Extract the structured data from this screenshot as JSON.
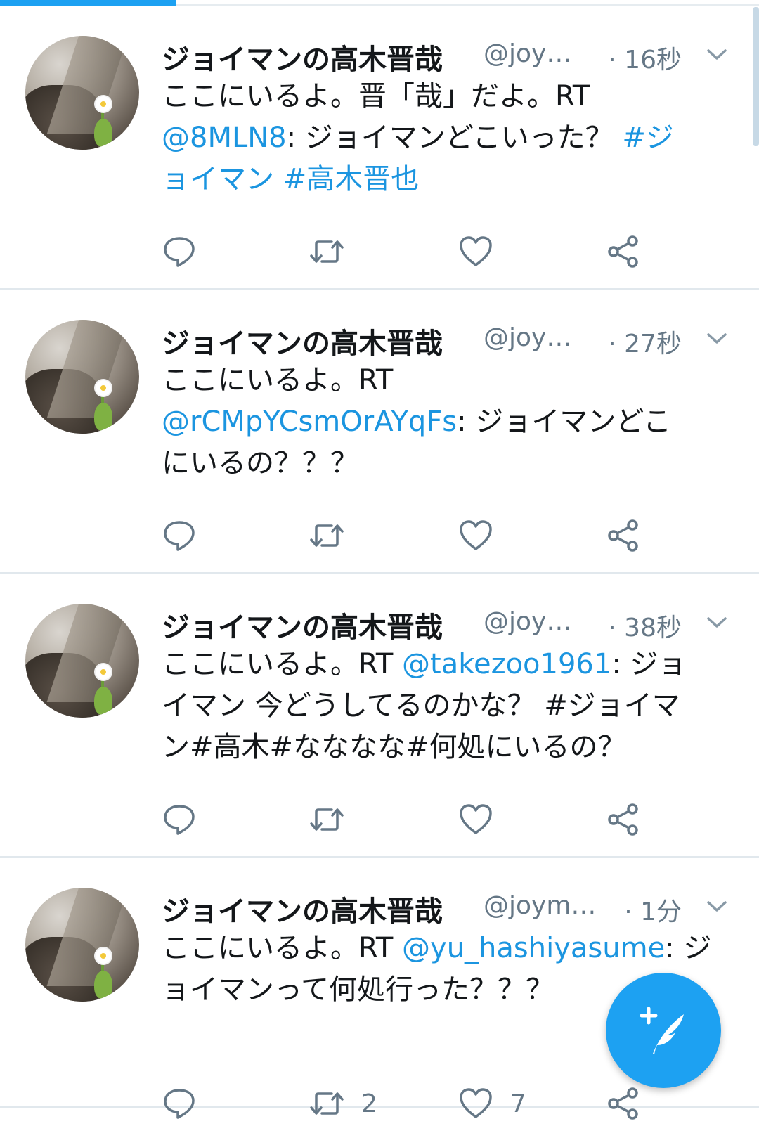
{
  "colors": {
    "accent": "#1da1f2",
    "link": "#1b95e0",
    "muted": "#657786",
    "text": "#14171a"
  },
  "tweets": [
    {
      "name": "ジョイマンの高木晋哉",
      "handle": "@joy…",
      "time": "· 16秒",
      "segments": [
        {
          "t": "ここにいるよ。晋「哉」だよ。RT\n"
        },
        {
          "t": "@8MLN8",
          "link": true
        },
        {
          "t": ": ジョイマンどこいった？ "
        },
        {
          "t": "#ジ\nョイマン #高木晋也",
          "link": true
        }
      ],
      "retweets": "",
      "likes": ""
    },
    {
      "name": "ジョイマンの高木晋哉",
      "handle": "@joy…",
      "time": "· 27秒",
      "segments": [
        {
          "t": "ここにいるよ。RT\n"
        },
        {
          "t": "@rCMpYCsmOrAYqFs",
          "link": true
        },
        {
          "t": ": ジョイマンどこ\nにいるの？？？"
        }
      ],
      "retweets": "",
      "likes": ""
    },
    {
      "name": "ジョイマンの高木晋哉",
      "handle": "@joy…",
      "time": "· 38秒",
      "segments": [
        {
          "t": "ここにいるよ。RT "
        },
        {
          "t": "@takezoo1961",
          "link": true
        },
        {
          "t": ": ジョ\nイマン 今どうしてるのかな？ #ジョイマ\nン#高木#なななな#何処にいるの？"
        }
      ],
      "retweets": "",
      "likes": ""
    },
    {
      "name": "ジョイマンの高木晋哉",
      "handle": "@joym…",
      "time": "· 1分",
      "segments": [
        {
          "t": "ここにいるよ。RT "
        },
        {
          "t": "@yu_hashiyasume",
          "link": true
        },
        {
          "t": ": ジ\nョイマンって何処行った？？？"
        }
      ],
      "retweets": "2",
      "likes": "7"
    }
  ],
  "icons": {
    "reply": "reply-icon",
    "retweet": "retweet-icon",
    "like": "heart-icon",
    "share": "share-icon",
    "caret": "chevron-down-icon",
    "compose": "compose-tweet-icon"
  }
}
